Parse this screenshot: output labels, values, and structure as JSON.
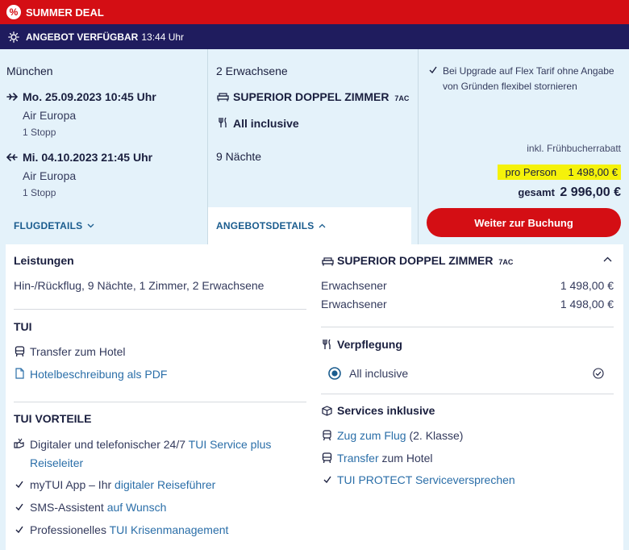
{
  "deal_bar": {
    "icon": "percent-icon",
    "text": "SUMMER DEAL"
  },
  "offer_bar": {
    "icon": "sun-icon",
    "label": "ANGEBOT VERFÜGBAR",
    "time": "13:44 Uhr"
  },
  "flight": {
    "origin": "München",
    "outbound": {
      "datetime": "Mo. 25.09.2023 10:45 Uhr",
      "airline": "Air Europa",
      "stops": "1 Stopp"
    },
    "inbound": {
      "datetime": "Mi. 04.10.2023 21:45 Uhr",
      "airline": "Air Europa",
      "stops": "1 Stopp"
    },
    "details_link": "FLUGDETAILS"
  },
  "offer": {
    "travellers": "2 Erwachsene",
    "room": "SUPERIOR DOPPEL ZIMMER",
    "room_code": "7AC",
    "board": "All inclusive",
    "nights": "9 Nächte",
    "details_tab": "ANGEBOTSDETAILS"
  },
  "price": {
    "flex_note": "Bei Upgrade auf Flex Tarif ohne Angabe von Gründen flexibel stornieren",
    "discount_note": "inkl. Frühbucherrabatt",
    "per_person_label": "pro Person",
    "per_person_value": "1 498,00 €",
    "total_label": "gesamt",
    "total_value": "2 996,00 €",
    "book_button": "Weiter zur Buchung"
  },
  "details": {
    "left": {
      "services_heading": "Leistungen",
      "services_text": "Hin-/Rückflug, 9 Nächte, 1 Zimmer, 2 Erwachsene",
      "tui_heading": "TUI",
      "transfer": "Transfer zum Hotel",
      "pdf_link": "Hotelbeschreibung als PDF",
      "benefits_heading": "TUI VORTEILE",
      "benefit1_a": "Digitaler und telefonischer 24/7 ",
      "benefit1_b": "TUI Service plus",
      "benefit1_c": "Reiseleiter",
      "benefit2_a": "myTUI App – Ihr ",
      "benefit2_b": "digitaler Reiseführer",
      "benefit3_a": "SMS-Assistent ",
      "benefit3_b": "auf Wunsch",
      "benefit4_a": "Professionelles ",
      "benefit4_b": "TUI Krisenmanagement"
    },
    "right": {
      "room_heading": "SUPERIOR DOPPEL ZIMMER",
      "room_code": "7AC",
      "rows": [
        {
          "label": "Erwachsener",
          "price": "1 498,00 €"
        },
        {
          "label": "Erwachsener",
          "price": "1 498,00 €"
        }
      ],
      "board_heading": "Verpflegung",
      "board_option": "All inclusive",
      "services_heading": "Services inklusive",
      "service1_a": "Zug zum Flug",
      "service1_b": " (2. Klasse)",
      "service2_a": "Transfer",
      "service2_b": " zum Hotel",
      "service3_a": "TUI PROTECT",
      "service3_b": " Serviceversprechen"
    }
  },
  "colors": {
    "red": "#d40e14",
    "navy": "#1f1c5e",
    "light_blue": "#e4f2fa",
    "link": "#2a6ea8",
    "highlight": "#f5f20a"
  }
}
